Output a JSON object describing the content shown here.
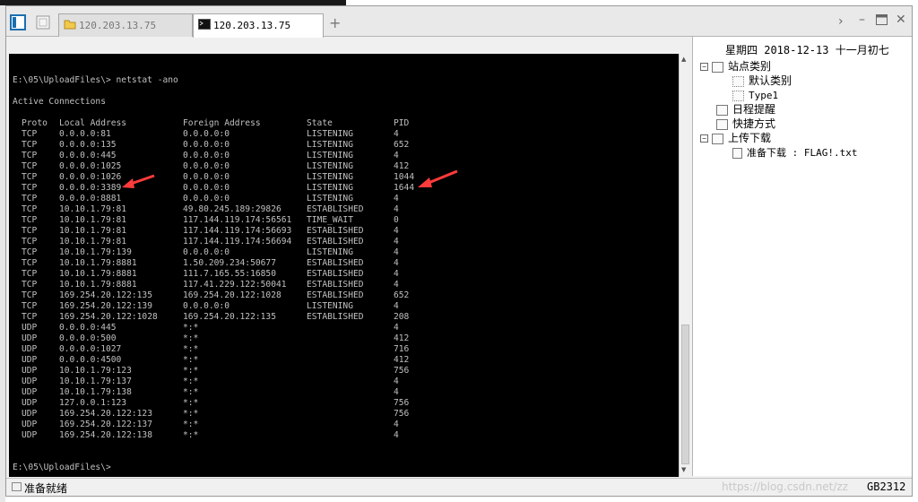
{
  "tabs": [
    {
      "label": "120.203.13.75",
      "icon": "folder-icon",
      "active": false
    },
    {
      "label": "120.203.13.75",
      "icon": "terminal-icon",
      "active": true
    }
  ],
  "terminal": {
    "command_line": "E:\\05\\UploadFiles\\> netstat -ano",
    "section_title": "Active Connections",
    "headers": [
      "Proto",
      "Local Address",
      "Foreign Address",
      "State",
      "PID"
    ],
    "rows": [
      [
        "TCP",
        "0.0.0.0:81",
        "0.0.0.0:0",
        "LISTENING",
        "4"
      ],
      [
        "TCP",
        "0.0.0.0:135",
        "0.0.0.0:0",
        "LISTENING",
        "652"
      ],
      [
        "TCP",
        "0.0.0.0:445",
        "0.0.0.0:0",
        "LISTENING",
        "4"
      ],
      [
        "TCP",
        "0.0.0.0:1025",
        "0.0.0.0:0",
        "LISTENING",
        "412"
      ],
      [
        "TCP",
        "0.0.0.0:1026",
        "0.0.0.0:0",
        "LISTENING",
        "1044"
      ],
      [
        "TCP",
        "0.0.0.0:3389",
        "0.0.0.0:0",
        "LISTENING",
        "1644"
      ],
      [
        "TCP",
        "0.0.0.0:8881",
        "0.0.0.0:0",
        "LISTENING",
        "4"
      ],
      [
        "TCP",
        "10.10.1.79:81",
        "49.80.245.189:29826",
        "ESTABLISHED",
        "4"
      ],
      [
        "TCP",
        "10.10.1.79:81",
        "117.144.119.174:56561",
        "TIME_WAIT",
        "0"
      ],
      [
        "TCP",
        "10.10.1.79:81",
        "117.144.119.174:56693",
        "ESTABLISHED",
        "4"
      ],
      [
        "TCP",
        "10.10.1.79:81",
        "117.144.119.174:56694",
        "ESTABLISHED",
        "4"
      ],
      [
        "TCP",
        "10.10.1.79:139",
        "0.0.0.0:0",
        "LISTENING",
        "4"
      ],
      [
        "TCP",
        "10.10.1.79:8881",
        "1.50.209.234:50677",
        "ESTABLISHED",
        "4"
      ],
      [
        "TCP",
        "10.10.1.79:8881",
        "111.7.165.55:16850",
        "ESTABLISHED",
        "4"
      ],
      [
        "TCP",
        "10.10.1.79:8881",
        "117.41.229.122:50041",
        "ESTABLISHED",
        "4"
      ],
      [
        "TCP",
        "169.254.20.122:135",
        "169.254.20.122:1028",
        "ESTABLISHED",
        "652"
      ],
      [
        "TCP",
        "169.254.20.122:139",
        "0.0.0.0:0",
        "LISTENING",
        "4"
      ],
      [
        "TCP",
        "169.254.20.122:1028",
        "169.254.20.122:135",
        "ESTABLISHED",
        "208"
      ],
      [
        "UDP",
        "0.0.0.0:445",
        "*:*",
        "",
        "4"
      ],
      [
        "UDP",
        "0.0.0.0:500",
        "*:*",
        "",
        "412"
      ],
      [
        "UDP",
        "0.0.0.0:1027",
        "*:*",
        "",
        "716"
      ],
      [
        "UDP",
        "0.0.0.0:4500",
        "*:*",
        "",
        "412"
      ],
      [
        "UDP",
        "10.10.1.79:123",
        "*:*",
        "",
        "756"
      ],
      [
        "UDP",
        "10.10.1.79:137",
        "*:*",
        "",
        "4"
      ],
      [
        "UDP",
        "10.10.1.79:138",
        "*:*",
        "",
        "4"
      ],
      [
        "UDP",
        "127.0.0.1:123",
        "*:*",
        "",
        "756"
      ],
      [
        "UDP",
        "169.254.20.122:123",
        "*:*",
        "",
        "756"
      ],
      [
        "UDP",
        "169.254.20.122:137",
        "*:*",
        "",
        "4"
      ],
      [
        "UDP",
        "169.254.20.122:138",
        "*:*",
        "",
        "4"
      ]
    ],
    "prompt": "E:\\05\\UploadFiles\\>",
    "colors": {
      "background": "#000000",
      "text": "#c0c0c0",
      "annotation_arrow": "#ff3b3b"
    }
  },
  "sidebar": {
    "date": "星期四 2018-12-13 十一月初七",
    "tree": [
      {
        "label": "站点类别",
        "expander": "−",
        "icon": "category-icon"
      },
      {
        "label": "默认类别",
        "icon": "item-icon"
      },
      {
        "label": "Type1",
        "icon": "item-icon"
      },
      {
        "label": "日程提醒",
        "expander": "",
        "icon": "schedule-icon"
      },
      {
        "label": "快捷方式",
        "icon": "shortcut-icon"
      },
      {
        "label": "上传下载",
        "expander": "−",
        "icon": "transfer-icon"
      },
      {
        "label": "准备下载 : FLAG!.txt",
        "icon": "file-icon"
      }
    ]
  },
  "statusbar": {
    "text": "准备就绪",
    "watermark": "https://blog.csdn.net/zz",
    "encoding": "GB2312"
  }
}
